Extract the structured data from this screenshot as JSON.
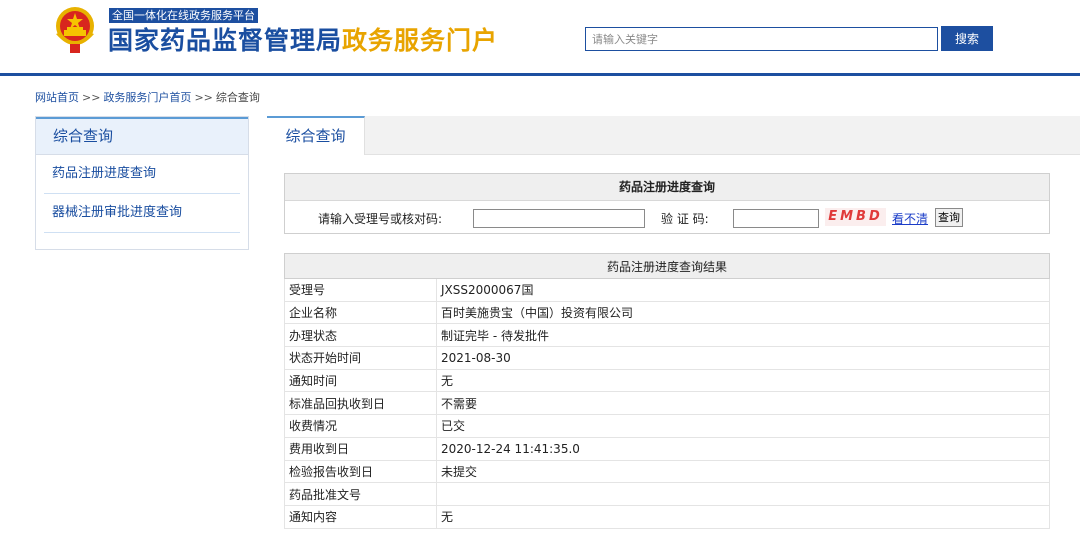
{
  "header": {
    "platform_tag": "全国一体化在线政务服务平台",
    "title_main": "国家药品监督管理局",
    "title_accent": "政务服务门户",
    "search_placeholder": "请输入关键字",
    "search_button": "搜索",
    "emblem_icon": "national-emblem-icon",
    "brand_blue": "#1d4fa0",
    "accent_gold": "#e8a400"
  },
  "breadcrumb": {
    "items": [
      "网站首页",
      "政务服务门户首页",
      "综合查询"
    ],
    "separator": ">>"
  },
  "sidebar": {
    "title": "综合查询",
    "items": [
      "药品注册进度查询",
      "器械注册审批进度查询"
    ]
  },
  "tabs": {
    "active": "综合查询"
  },
  "query": {
    "title": "药品注册进度查询",
    "id_label": "请输入受理号或核对码:",
    "id_value": "",
    "captcha_label": "验 证 码:",
    "captcha_value": "",
    "captcha_image_text": "EMBD",
    "refresh_link": "看不清",
    "submit_button": "查询"
  },
  "result": {
    "title": "药品注册进度查询结果",
    "rows": [
      {
        "label": "受理号",
        "value": "JXSS2000067国"
      },
      {
        "label": "企业名称",
        "value": "百时美施贵宝（中国）投资有限公司"
      },
      {
        "label": "办理状态",
        "value": "制证完毕 - 待发批件"
      },
      {
        "label": "状态开始时间",
        "value": "2021-08-30"
      },
      {
        "label": "通知时间",
        "value": "无"
      },
      {
        "label": "标准品回执收到日",
        "value": "不需要"
      },
      {
        "label": "收费情况",
        "value": "已交"
      },
      {
        "label": "费用收到日",
        "value": "2020-12-24 11:41:35.0"
      },
      {
        "label": "检验报告收到日",
        "value": "未提交"
      },
      {
        "label": "药品批准文号",
        "value": ""
      },
      {
        "label": "通知内容",
        "value": "无"
      }
    ]
  }
}
